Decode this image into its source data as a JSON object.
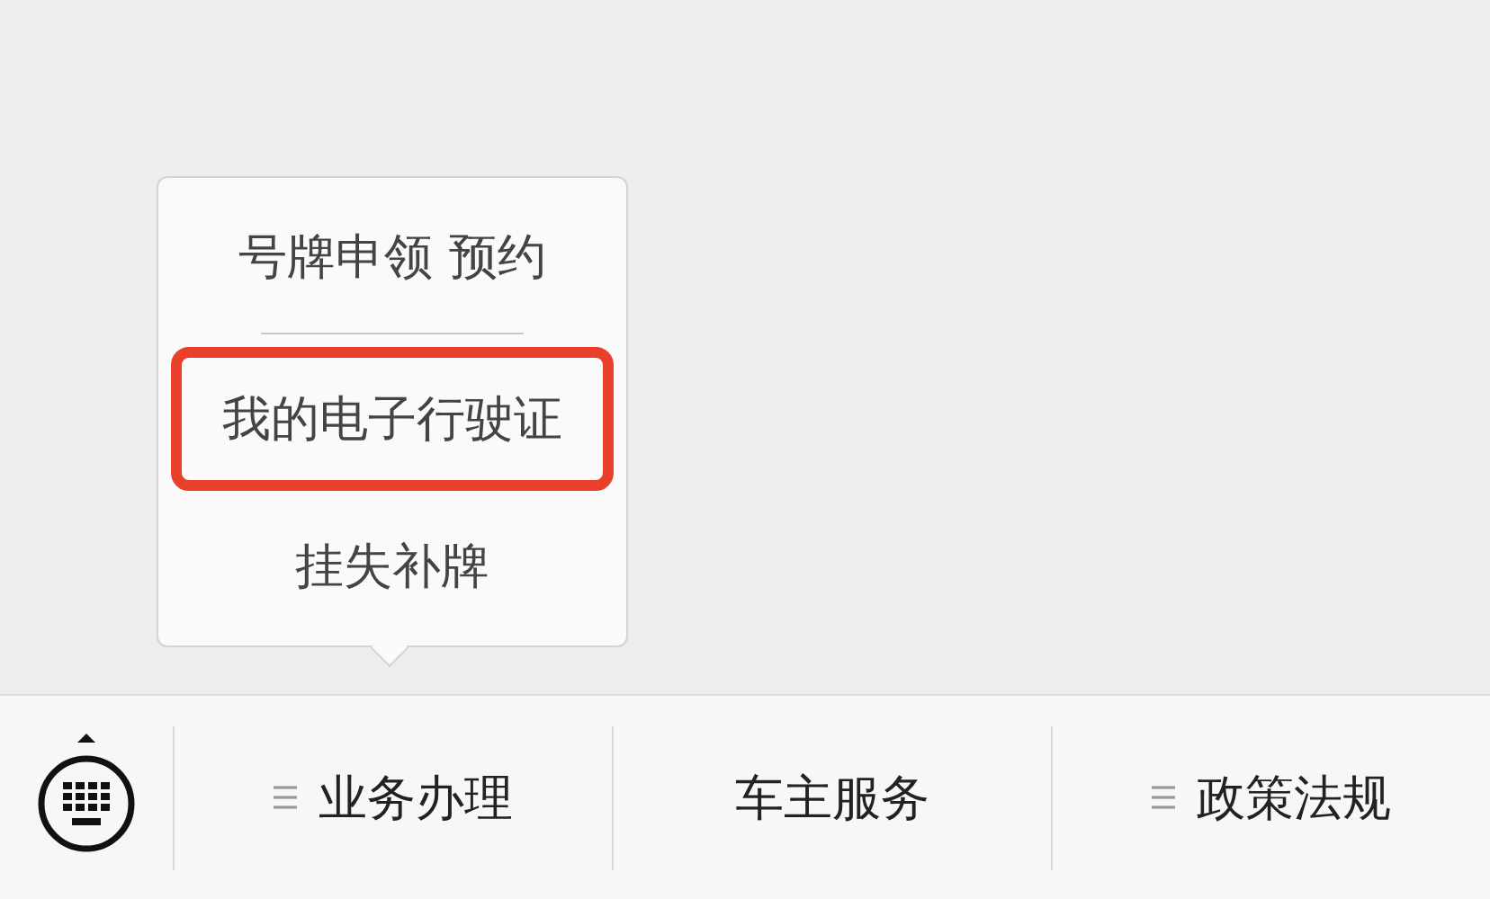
{
  "menus": [
    {
      "label": "业务办理",
      "kind": "submenu",
      "items": [
        {
          "label": "号牌申领 预约",
          "highlighted": false
        },
        {
          "label": "我的电子行驶证",
          "highlighted": true
        },
        {
          "label": "挂失补牌",
          "highlighted": false
        }
      ]
    },
    {
      "label": "车主服务",
      "kind": "link"
    },
    {
      "label": "政策法规",
      "kind": "submenu"
    }
  ]
}
